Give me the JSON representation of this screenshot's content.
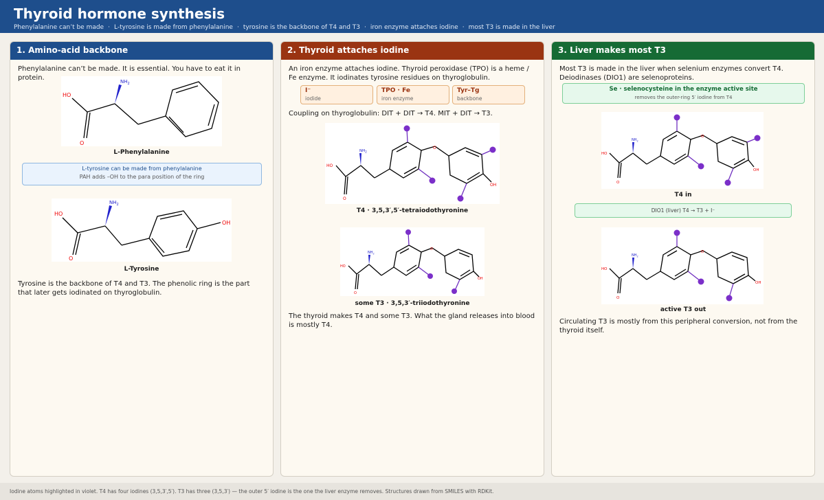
{
  "header": {
    "title": "Thyroid hormone synthesis",
    "subtitle_items": [
      "Phenylalanine can’t be made",
      "L-tyrosine is made from phenylalanine",
      "tyrosine is the backbone of T4 and T3",
      "iron enzyme attaches iodine",
      "most T3 is made in the liver"
    ],
    "sep": "·"
  },
  "colors": {
    "header": "#1e4e8c",
    "panel1": "#1e4e8c",
    "panel2": "#9a3412",
    "panel3": "#166b35",
    "iodine": "#7b2fc9"
  },
  "panel1": {
    "title": "1. Amino-acid backbone",
    "intro": "Phenylalanine can’t be made. It is essential. You have to eat it in protein.",
    "mol1_caption": "L-Phenylalanine",
    "note_line1": "L-tyrosine can be made from phenylalanine",
    "note_line2": "PAH adds –OH to the para position of the ring",
    "mol2_caption": "L-Tyrosine",
    "outro": "Tyrosine is the backbone of T4 and T3. The phenolic ring is the part that later gets iodinated on thyroglobulin."
  },
  "panel2": {
    "title": "2. Thyroid attaches iodine",
    "intro": "An iron enzyme attaches iodine. Thyroid peroxidase (TPO) is a heme / Fe enzyme. It iodinates tyrosine residues on thyroglobulin.",
    "chips": [
      {
        "title": "I⁻",
        "sub": "iodide"
      },
      {
        "title": "TPO · Fe",
        "sub": "iron enzyme"
      },
      {
        "title": "Tyr–Tg",
        "sub": "backbone"
      }
    ],
    "coupling": "Coupling on thyroglobulin: DIT + DIT → T4. MIT + DIT → T3.",
    "mol1_caption": "T4  ·  3,5,3′,5′-tetraiodothyronine",
    "mol2_caption": "some T3  ·  3,5,3′-triiodothyronine",
    "outro": "The thyroid makes T4 and some T3. What the gland releases into blood is mostly T4."
  },
  "panel3": {
    "title": "3. Liver makes most T3",
    "intro": "Most T3 is made in the liver when selenium enzymes convert T4. Deiodinases (DIO1) are selenoproteins.",
    "se_line1": "Se  ·  selenocysteine in the enzyme active site",
    "se_line2": "removes the outer-ring 5′ iodine from T4",
    "mol1_caption": "T4 in",
    "dio_line": "DIO1 (liver)   T4  →  T3 + I⁻",
    "mol2_caption": "active T3 out",
    "outro": "Circulating T3 is mostly from this peripheral conversion, not from the thyroid itself."
  },
  "atoms": {
    "oxygen": "O",
    "hydroxyl": "HO",
    "hydroxyl_right": "OH",
    "amine": "NH",
    "amine_sub": "2"
  },
  "footer": "Iodine atoms highlighted in violet.  T4 has four iodines (3,5,3′,5′).  T3 has three (3,5,3′) — the outer 5′ iodine is the one the liver enzyme removes.  Structures drawn from SMILES with RDKit."
}
